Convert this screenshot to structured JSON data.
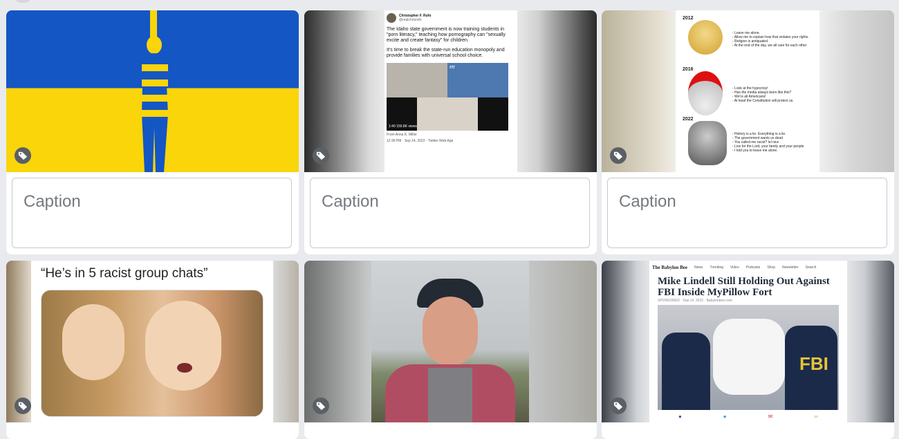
{
  "cards": [
    {
      "id": "flag",
      "caption_placeholder": "Caption"
    },
    {
      "id": "tweet",
      "caption_placeholder": "Caption"
    },
    {
      "id": "meme",
      "caption_placeholder": "Caption"
    },
    {
      "id": "whisper",
      "caption_placeholder": "Caption"
    },
    {
      "id": "man",
      "caption_placeholder": ""
    },
    {
      "id": "bee",
      "caption_placeholder": ""
    }
  ],
  "tweet": {
    "author": "Christopher F. Rufo",
    "handle": "@realchrisrufo",
    "para1": "The Idaho state government is now training students in \"porn literacy,\" teaching how pornography can \"sexually excite and create fantasy\" for children.",
    "para2": "It's time to break the state-run education monopoly and provide families with universal school choice.",
    "video_time": "1:40",
    "video_views": "159.8K views",
    "from": "From Anna K. Miller",
    "timestamp": "12:39 PM · Sep 14, 2022 · Twitter Web App",
    "video_logo": "etr"
  },
  "meme": {
    "years": [
      "2012",
      "2016",
      "2022"
    ],
    "lines_2012": "- Leave me alone.\n- Allow me to explain how that violates your rights.\n- Religion is antiquated.\n- At the end of the day, we all care for each other",
    "lines_2016": "- Look at the hypocrisy!\n- Has the media always been like this?\n- We're all Americans!\n- At least the Constitution will protect us.",
    "lines_2022": "- History is a lie. Everything is a lie.\n- The government wants us dead\n- You called me racist? lol nice\n- Live for the Lord, your family and your people\n- I told you to leave me alone."
  },
  "whisper": {
    "quote": "“He’s in 5 racist group chats”"
  },
  "bee": {
    "logo": "The Babylon Bee",
    "nav": [
      "News",
      "Trending",
      "Video",
      "Podcasts",
      "Shop",
      "Newsletter",
      "Search"
    ],
    "headline": "Mike Lindell Still Holding Out Against FBI Inside MyPillow Fort",
    "meta": "SPONSORED · Sep 14, 2022 · Babylonbee.com",
    "fbi_label": "FBI"
  },
  "colors": {
    "flag_blue": "#1456c4",
    "flag_yellow": "#f9d50a",
    "tag_badge": "#5b5f66",
    "fbi_jacket": "#1c2a4a"
  }
}
